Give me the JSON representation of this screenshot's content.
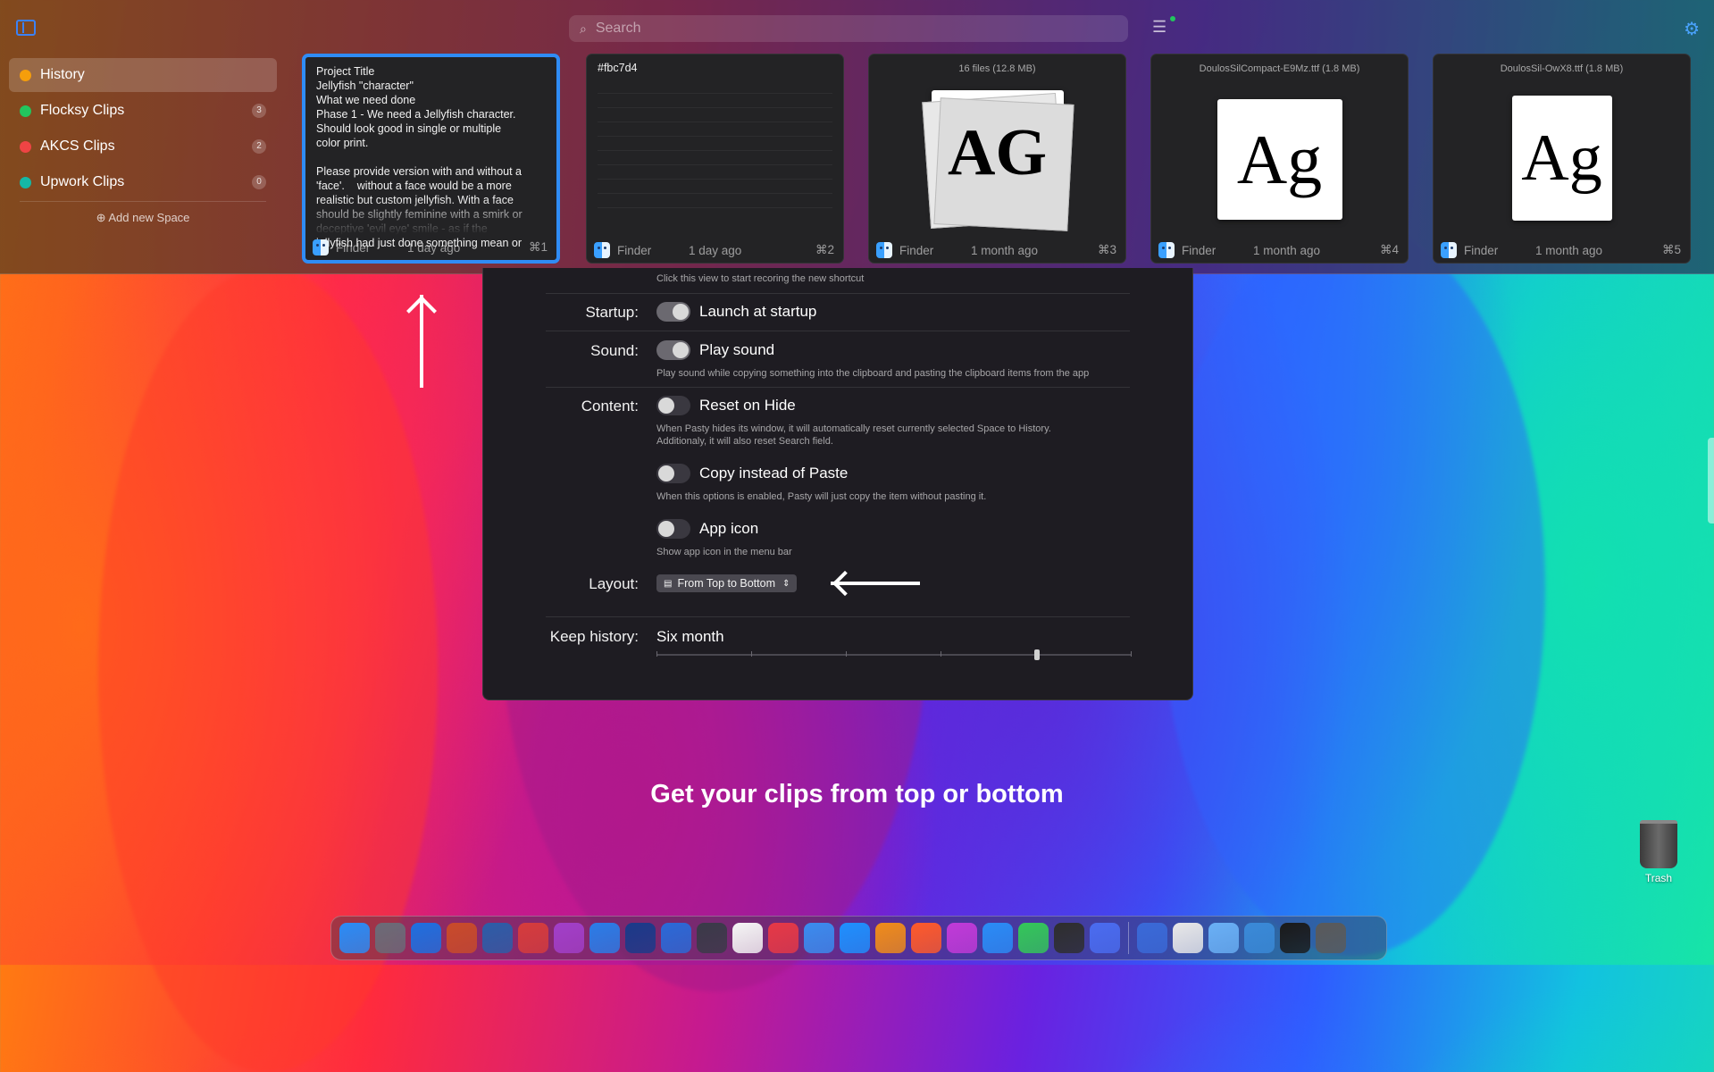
{
  "search": {
    "placeholder": "Search"
  },
  "spaces": {
    "items": [
      {
        "label": "History",
        "count": "",
        "color": "#f59e0b",
        "active": true
      },
      {
        "label": "Flocksy Clips",
        "count": "3",
        "color": "#22c55e"
      },
      {
        "label": "AKCS Clips",
        "count": "2",
        "color": "#ef4444"
      },
      {
        "label": "Upwork Clips",
        "count": "0",
        "color": "#14b8a6"
      }
    ],
    "add_label": "⊕ Add new Space"
  },
  "cards": [
    {
      "type": "text",
      "content": "Project Title\nJellyfish \"character\"\nWhat we need done\nPhase 1 - We need a Jellyfish character.\nShould look good in single or multiple\ncolor print.\n\nPlease provide version with and without a\n'face'.    without a face would be a more\nrealistic but custom jellyfish. With a face\nshould be slightly feminine with a smirk or\ndeceptive 'evil eye' smile - as if the\njellyfish had just done something mean or",
      "app": "Finder",
      "time": "1 day ago",
      "shortcut": "⌘1",
      "selected": true
    },
    {
      "type": "color",
      "title": "#fbc7d4",
      "app": "Finder",
      "time": "1 day ago",
      "shortcut": "⌘2"
    },
    {
      "type": "files",
      "header": "16 files (12.8 MB)",
      "glyph": "AG",
      "app": "Finder",
      "time": "1 month ago",
      "shortcut": "⌘3"
    },
    {
      "type": "font",
      "header": "DoulosSilCompact-E9Mz.ttf (1.8 MB)",
      "glyph": "Ag",
      "app": "Finder",
      "time": "1 month ago",
      "shortcut": "⌘4"
    },
    {
      "type": "font",
      "header": "DoulosSil-OwX8.ttf (1.8 MB)",
      "glyph": "Ag",
      "app": "Finder",
      "time": "1 month ago",
      "shortcut": "⌘5"
    }
  ],
  "settings": {
    "shortcut_hint": "Click this view to start recoring the new shortcut",
    "startup": {
      "label": "Startup:",
      "option": "Launch at startup",
      "on": true
    },
    "sound": {
      "label": "Sound:",
      "option": "Play sound",
      "on": true,
      "hint": "Play sound while copying something into the clipboard and pasting the clipboard items from the app"
    },
    "content": {
      "label": "Content:",
      "reset": {
        "option": "Reset on Hide",
        "on": false,
        "hint": "When Pasty hides its window, it will automatically reset currently selected Space to History.\nAdditionaly,  it will also reset Search field."
      },
      "copy": {
        "option": "Copy instead of Paste",
        "on": false,
        "hint": "When this options is enabled, Pasty will just copy the item without pasting it."
      },
      "appicon": {
        "option": "App icon",
        "on": false,
        "hint": "Show app icon in the menu bar"
      }
    },
    "layout": {
      "label": "Layout:",
      "value": "From Top to Bottom"
    },
    "history": {
      "label": "Keep history:",
      "value": "Six month",
      "slider_fraction": 0.8
    }
  },
  "caption": "Get your clips from top or bottom",
  "trash_label": "Trash",
  "dock_colors": [
    "#2a8cf7",
    "#6b6b78",
    "#1e6fe0",
    "#c94b2a",
    "#2c5da8",
    "#d63c3c",
    "#a23fc9",
    "#2a7de8",
    "#1a3a8a",
    "#2a6ad8",
    "#3a3a48",
    "#f5f5f5",
    "#e63946",
    "#3a8cf0",
    "#1e90ff",
    "#f08c1a",
    "#ff5a2a",
    "#c13ad8",
    "#2a8cf7",
    "#34c759",
    "#2e2e2e",
    "#4a6cf0",
    "#3a6ad8",
    "#e8e8e8",
    "#6ab0f5",
    "#3a8ad8",
    "#1a1a1a",
    "#5a5a5a"
  ],
  "colors": {
    "accent": "#2f8cf5",
    "settings_bg": "#1e1c22"
  }
}
